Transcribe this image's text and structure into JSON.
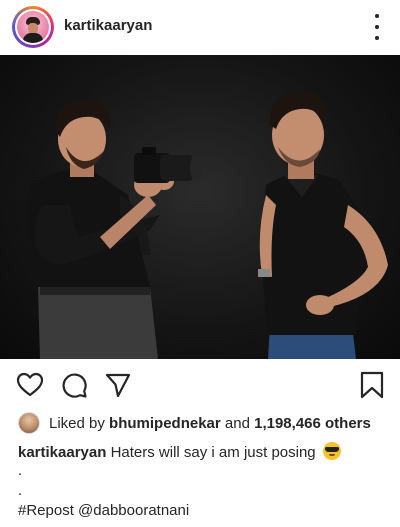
{
  "post": {
    "username": "kartikaaryan",
    "photo_alt": "",
    "likes": {
      "prefix": "Liked by",
      "liker": "bhumipednekar",
      "middle": "and",
      "count": "1,198,466 others"
    },
    "caption": {
      "username": "kartikaaryan",
      "text": "Haters will say i am just posing"
    },
    "dots": [
      ".",
      "."
    ],
    "repost_line": "#Repost @dabbooratnani"
  },
  "icons": {
    "more": "more-vertical-icon",
    "like": "heart-icon",
    "comment": "comment-icon",
    "share": "send-icon",
    "save": "bookmark-icon",
    "emoji": "sunglasses-emoji"
  },
  "colors": {
    "text": "#262626",
    "photo_background": "#141414"
  }
}
